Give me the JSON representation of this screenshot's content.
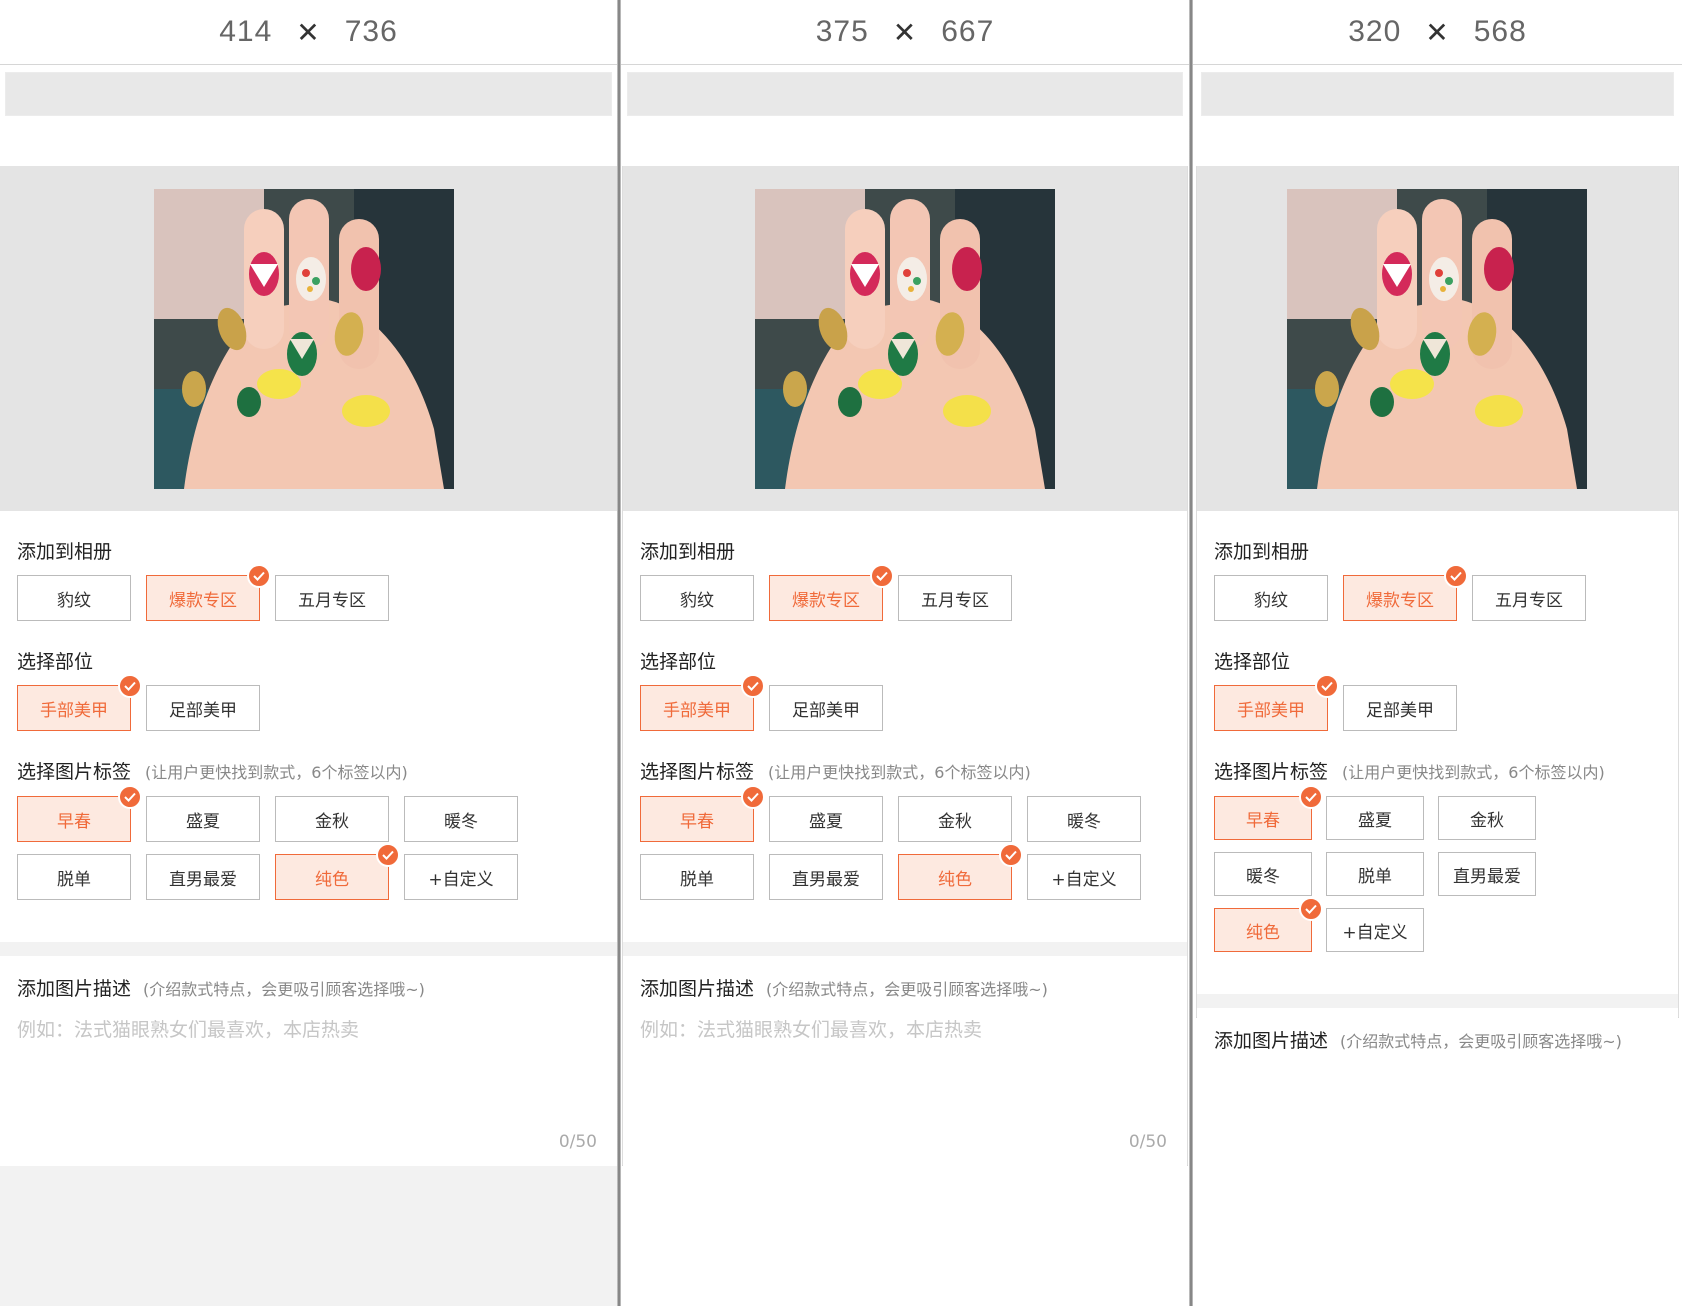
{
  "frames": [
    {
      "width": "414",
      "height": "736"
    },
    {
      "width": "375",
      "height": "667"
    },
    {
      "width": "320",
      "height": "568"
    }
  ],
  "dimension_separator": "✕",
  "form": {
    "album_label": "添加到相册",
    "albums": [
      "豹纹",
      "爆款专区",
      "五月专区"
    ],
    "selected_album": "爆款专区",
    "part_label": "选择部位",
    "parts": [
      "手部美甲",
      "足部美甲"
    ],
    "selected_part": "手部美甲",
    "tag_label": "选择图片标签",
    "tag_hint": "(让用户更快找到款式，6个标签以内)",
    "tags": [
      "早春",
      "盛夏",
      "金秋",
      "暖冬",
      "脱单",
      "直男最爱",
      "纯色",
      "+自定义"
    ],
    "selected_tags": [
      "早春",
      "纯色"
    ],
    "desc_label": "添加图片描述",
    "desc_hint": "(介绍款式特点，会更吸引顾客选择哦~)",
    "desc_placeholder": "例如：法式猫眼熟女们最喜欢，本店热卖",
    "desc_counter": "0/50"
  },
  "colors": {
    "accent": "#f06a3a",
    "selected_bg": "#fde9e0",
    "page_bg": "#f2f2f2"
  }
}
